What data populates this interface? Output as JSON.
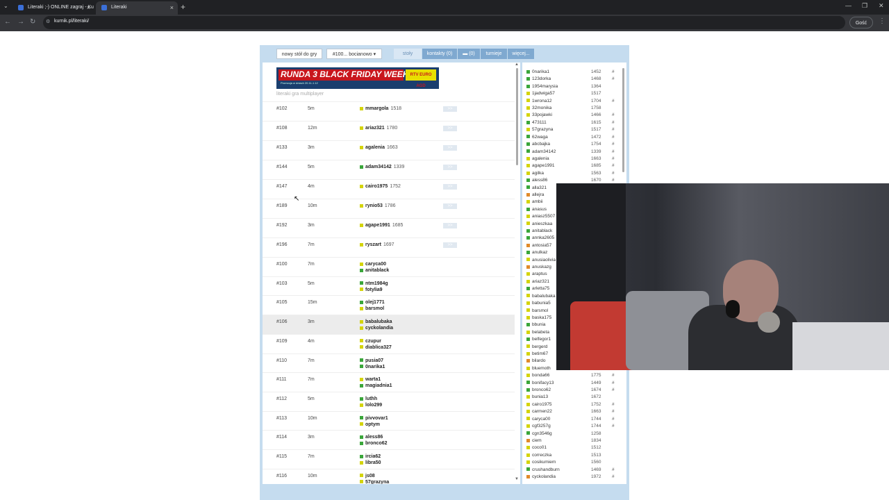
{
  "browser": {
    "tabs": [
      {
        "label": "Literaki ;-) ONLINE zagraj - Ku"
      },
      {
        "label": "Literaki"
      }
    ],
    "url": "kurnik.pl/literaki/",
    "guest_label": "Gość"
  },
  "toolbar": {
    "new_table": "nowy stół do gry",
    "room_select": "#100... bocianowo",
    "tables": "stoły",
    "contacts": "kontakty (0)",
    "chat": "(0)",
    "tournaments": "turnieje",
    "more": "więcej..."
  },
  "ad": {
    "headline": "RUNDA 3 BLACK FRIDAY WEEKS",
    "sub": "Promocja w dniach 20.11-1.12",
    "logo": "RTV EURO AGD"
  },
  "caption": "literaki gra multiplayer",
  "join_label": ">>",
  "tables": [
    {
      "num": "#102",
      "time": "5m",
      "players": [
        {
          "name": "mmargola",
          "rating": "1518",
          "color": "#d4d40a"
        }
      ],
      "join": true
    },
    {
      "num": "#108",
      "time": "12m",
      "players": [
        {
          "name": "ariaz321",
          "rating": "1780",
          "color": "#d4d40a"
        }
      ],
      "join": true
    },
    {
      "num": "#133",
      "time": "3m",
      "players": [
        {
          "name": "agalenia",
          "rating": "1663",
          "color": "#d4d40a"
        }
      ],
      "join": true
    },
    {
      "num": "#144",
      "time": "5m",
      "players": [
        {
          "name": "adam34142",
          "rating": "1339",
          "color": "#3aa63a"
        }
      ],
      "join": true
    },
    {
      "num": "#147",
      "time": "4m",
      "players": [
        {
          "name": "cairo1975",
          "rating": "1752",
          "color": "#d4d40a"
        }
      ],
      "join": true
    },
    {
      "num": "#189",
      "time": "10m",
      "players": [
        {
          "name": "rynio53",
          "rating": "1786",
          "color": "#d4d40a"
        }
      ],
      "join": true
    },
    {
      "num": "#192",
      "time": "3m",
      "players": [
        {
          "name": "agape1991",
          "rating": "1685",
          "color": "#d4d40a"
        }
      ],
      "join": true
    },
    {
      "num": "#196",
      "time": "7m",
      "players": [
        {
          "name": "ryszart",
          "rating": "1697",
          "color": "#d4d40a"
        }
      ],
      "join": true
    },
    {
      "num": "#100",
      "time": "7m",
      "players": [
        {
          "name": "caryca00",
          "rating": "",
          "color": "#d4d40a"
        },
        {
          "name": "anitablack",
          "rating": "",
          "color": "#3aa63a"
        }
      ],
      "join": false
    },
    {
      "num": "#103",
      "time": "5m",
      "players": [
        {
          "name": "ntm1984g",
          "rating": "",
          "color": "#3aa63a"
        },
        {
          "name": "fotylia9",
          "rating": "",
          "color": "#d4d40a"
        }
      ],
      "join": false
    },
    {
      "num": "#105",
      "time": "15m",
      "players": [
        {
          "name": "olej1771",
          "rating": "",
          "color": "#3aa63a"
        },
        {
          "name": "barsmol",
          "rating": "",
          "color": "#d4d40a"
        }
      ],
      "join": false
    },
    {
      "num": "#106",
      "time": "3m",
      "players": [
        {
          "name": "babalubaka",
          "rating": "",
          "color": "#d4d40a"
        },
        {
          "name": "cyckolandia",
          "rating": "",
          "color": "#d4d40a"
        }
      ],
      "join": false,
      "highlight": true
    },
    {
      "num": "#109",
      "time": "4m",
      "players": [
        {
          "name": "czupur",
          "rating": "",
          "color": "#d4d40a"
        },
        {
          "name": "diablica327",
          "rating": "",
          "color": "#d4d40a"
        }
      ],
      "join": false
    },
    {
      "num": "#110",
      "time": "7m",
      "players": [
        {
          "name": "pusia07",
          "rating": "",
          "color": "#3aa63a"
        },
        {
          "name": "0narika1",
          "rating": "",
          "color": "#3aa63a"
        }
      ],
      "join": false
    },
    {
      "num": "#111",
      "time": "7m",
      "players": [
        {
          "name": "warta1",
          "rating": "",
          "color": "#d4d40a"
        },
        {
          "name": "magiadnia1",
          "rating": "",
          "color": "#3aa63a"
        }
      ],
      "join": false
    },
    {
      "num": "#112",
      "time": "5m",
      "players": [
        {
          "name": "luthh",
          "rating": "",
          "color": "#3aa63a"
        },
        {
          "name": "lolo299",
          "rating": "",
          "color": "#d4d40a"
        }
      ],
      "join": false
    },
    {
      "num": "#113",
      "time": "10m",
      "players": [
        {
          "name": "pivvovar1",
          "rating": "",
          "color": "#3aa63a"
        },
        {
          "name": "optym",
          "rating": "",
          "color": "#d4d40a"
        }
      ],
      "join": false
    },
    {
      "num": "#114",
      "time": "3m",
      "players": [
        {
          "name": "aless86",
          "rating": "",
          "color": "#3aa63a"
        },
        {
          "name": "bronco62",
          "rating": "",
          "color": "#3aa63a"
        }
      ],
      "join": false
    },
    {
      "num": "#115",
      "time": "7m",
      "players": [
        {
          "name": "ircia62",
          "rating": "",
          "color": "#3aa63a"
        },
        {
          "name": "libra50",
          "rating": "",
          "color": "#d4d40a"
        }
      ],
      "join": false
    },
    {
      "num": "#116",
      "time": "10m",
      "players": [
        {
          "name": "js08",
          "rating": "",
          "color": "#d4d40a"
        },
        {
          "name": "57grazyna",
          "rating": "",
          "color": "#d4d40a"
        }
      ],
      "join": false
    }
  ],
  "users": [
    {
      "name": "0narika1",
      "rating": "1452",
      "hash": "#",
      "color": "#3aa63a"
    },
    {
      "name": "123dorka",
      "rating": "1468",
      "hash": "#",
      "color": "#3aa63a"
    },
    {
      "name": "1954marysia",
      "rating": "1364",
      "hash": "",
      "color": "#3aa63a"
    },
    {
      "name": "1jadwiga57",
      "rating": "1517",
      "hash": "",
      "color": "#d4d40a"
    },
    {
      "name": "1wrona12",
      "rating": "1704",
      "hash": "#",
      "color": "#d4d40a"
    },
    {
      "name": "32monika",
      "rating": "1758",
      "hash": "",
      "color": "#d4d40a"
    },
    {
      "name": "33pojawki",
      "rating": "1466",
      "hash": "#",
      "color": "#d4d40a"
    },
    {
      "name": "473111",
      "rating": "1615",
      "hash": "#",
      "color": "#3aa63a"
    },
    {
      "name": "57grazyna",
      "rating": "1517",
      "hash": "#",
      "color": "#d4d40a"
    },
    {
      "name": "62waga",
      "rating": "1472",
      "hash": "#",
      "color": "#3aa63a"
    },
    {
      "name": "abcbajka",
      "rating": "1754",
      "hash": "#",
      "color": "#3aa63a"
    },
    {
      "name": "adam34142",
      "rating": "1339",
      "hash": "#",
      "color": "#3aa63a"
    },
    {
      "name": "agalenia",
      "rating": "1663",
      "hash": "#",
      "color": "#d4d40a"
    },
    {
      "name": "agape1991",
      "rating": "1685",
      "hash": "#",
      "color": "#d4d40a"
    },
    {
      "name": "agilka",
      "rating": "1563",
      "hash": "#",
      "color": "#d4d40a"
    },
    {
      "name": "aless86",
      "rating": "1670",
      "hash": "#",
      "color": "#3aa63a"
    },
    {
      "name": "alla321",
      "rating": "",
      "hash": "",
      "color": "#3aa63a"
    },
    {
      "name": "allejra",
      "rating": "",
      "hash": "",
      "color": "#e08a2a"
    },
    {
      "name": "ambii",
      "rating": "",
      "hash": "",
      "color": "#d4d40a"
    },
    {
      "name": "anasus",
      "rating": "",
      "hash": "",
      "color": "#3aa63a"
    },
    {
      "name": "aniasz5507",
      "rating": "",
      "hash": "",
      "color": "#d4d40a"
    },
    {
      "name": "anieszkaa",
      "rating": "",
      "hash": "",
      "color": "#d4d40a"
    },
    {
      "name": "anitablack",
      "rating": "",
      "hash": "",
      "color": "#3aa63a"
    },
    {
      "name": "annka2605",
      "rating": "",
      "hash": "",
      "color": "#3aa63a"
    },
    {
      "name": "antosia57",
      "rating": "",
      "hash": "",
      "color": "#e08a2a"
    },
    {
      "name": "anulkaz",
      "rating": "",
      "hash": "",
      "color": "#3aa63a"
    },
    {
      "name": "anusiaolivia",
      "rating": "",
      "hash": "",
      "color": "#d4d40a"
    },
    {
      "name": "anuskazg",
      "rating": "",
      "hash": "",
      "color": "#e08a2a"
    },
    {
      "name": "araptus",
      "rating": "",
      "hash": "",
      "color": "#d4d40a"
    },
    {
      "name": "ariaz321",
      "rating": "",
      "hash": "",
      "color": "#d4d40a"
    },
    {
      "name": "arletta75",
      "rating": "",
      "hash": "",
      "color": "#3aa63a"
    },
    {
      "name": "babalubaka",
      "rating": "",
      "hash": "",
      "color": "#d4d40a"
    },
    {
      "name": "babunia5",
      "rating": "",
      "hash": "",
      "color": "#d4d40a"
    },
    {
      "name": "barsmol",
      "rating": "",
      "hash": "",
      "color": "#d4d40a"
    },
    {
      "name": "baska175",
      "rating": "",
      "hash": "",
      "color": "#d4d40a"
    },
    {
      "name": "bbunia",
      "rating": "",
      "hash": "",
      "color": "#3aa63a"
    },
    {
      "name": "belabeta",
      "rating": "",
      "hash": "",
      "color": "#d4d40a"
    },
    {
      "name": "belfegor1",
      "rating": "",
      "hash": "",
      "color": "#3aa63a"
    },
    {
      "name": "bergerd",
      "rating": "",
      "hash": "",
      "color": "#d4d40a"
    },
    {
      "name": "betim67",
      "rating": "",
      "hash": "",
      "color": "#d4d40a"
    },
    {
      "name": "bilardo",
      "rating": "",
      "hash": "",
      "color": "#e08a2a"
    },
    {
      "name": "bluemoth",
      "rating": "",
      "hash": "",
      "color": "#d4d40a"
    },
    {
      "name": "bonda66",
      "rating": "1775",
      "hash": "#",
      "color": "#d4d40a"
    },
    {
      "name": "bonifacy13",
      "rating": "1449",
      "hash": "#",
      "color": "#3aa63a"
    },
    {
      "name": "bronco62",
      "rating": "1674",
      "hash": "#",
      "color": "#3aa63a"
    },
    {
      "name": "bunia13",
      "rating": "1672",
      "hash": "",
      "color": "#d4d40a"
    },
    {
      "name": "cairo1975",
      "rating": "1752",
      "hash": "#",
      "color": "#d4d40a"
    },
    {
      "name": "carmen22",
      "rating": "1663",
      "hash": "#",
      "color": "#d4d40a"
    },
    {
      "name": "caryca00",
      "rating": "1744",
      "hash": "#",
      "color": "#d4d40a"
    },
    {
      "name": "cgf3257g",
      "rating": "1744",
      "hash": "#",
      "color": "#d4d40a"
    },
    {
      "name": "cgn3546g",
      "rating": "1258",
      "hash": "",
      "color": "#3aa63a"
    },
    {
      "name": "ciem",
      "rating": "1834",
      "hash": "",
      "color": "#e08a2a"
    },
    {
      "name": "coco01",
      "rating": "1512",
      "hash": "",
      "color": "#d4d40a"
    },
    {
      "name": "correczka",
      "rating": "1513",
      "hash": "",
      "color": "#d4d40a"
    },
    {
      "name": "cosikumiem",
      "rating": "1560",
      "hash": "",
      "color": "#d4d40a"
    },
    {
      "name": "crushandburn",
      "rating": "1469",
      "hash": "#",
      "color": "#3aa63a"
    },
    {
      "name": "cyckolandia",
      "rating": "1972",
      "hash": "#",
      "color": "#e08a2a"
    }
  ]
}
